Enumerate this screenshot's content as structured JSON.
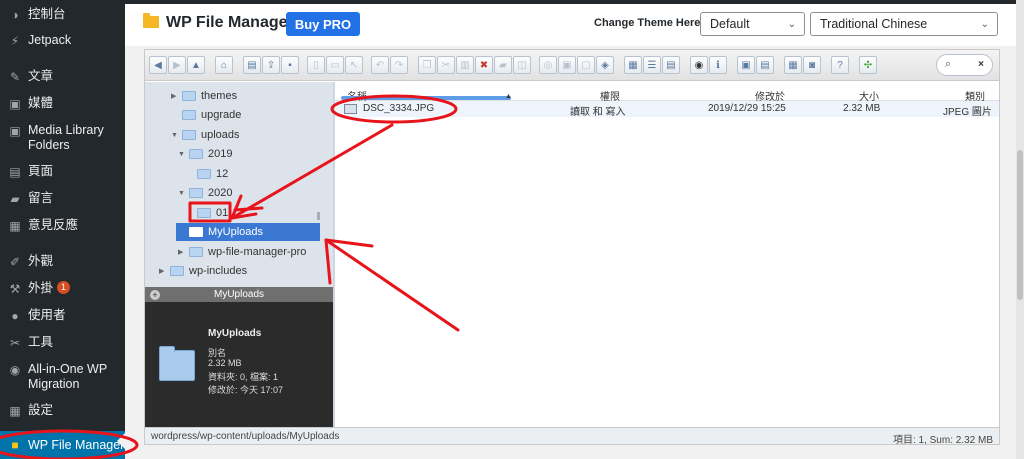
{
  "sidebar": {
    "items": [
      {
        "label": "控制台",
        "icon": "dashboard-icon"
      },
      {
        "label": "Jetpack",
        "icon": "jetpack-icon"
      },
      {
        "label": "文章",
        "icon": "pin-icon"
      },
      {
        "label": "媒體",
        "icon": "media-icon"
      },
      {
        "label": "Media Library Folders",
        "icon": "media-folders-icon"
      },
      {
        "label": "頁面",
        "icon": "page-icon"
      },
      {
        "label": "留言",
        "icon": "comment-icon"
      },
      {
        "label": "意見反應",
        "icon": "feedback-icon"
      },
      {
        "label": "外觀",
        "icon": "brush-icon"
      },
      {
        "label": "外掛",
        "icon": "plugin-icon",
        "badge": "1"
      },
      {
        "label": "使用者",
        "icon": "user-icon"
      },
      {
        "label": "工具",
        "icon": "wrench-icon"
      },
      {
        "label": "All-in-One WP Migration",
        "icon": "migration-icon"
      },
      {
        "label": "設定",
        "icon": "settings-icon"
      },
      {
        "label": "WP File Manager",
        "icon": "folder-icon"
      }
    ]
  },
  "header": {
    "title": "WP File Manager",
    "buy_pro": "Buy PRO",
    "theme_label": "Change Theme Here:",
    "theme_value": "Default",
    "language_value": "Traditional Chinese"
  },
  "tree": [
    {
      "label": "themes"
    },
    {
      "label": "upgrade"
    },
    {
      "label": "uploads"
    },
    {
      "label": "2019"
    },
    {
      "label": "12"
    },
    {
      "label": "2020"
    },
    {
      "label": "01"
    },
    {
      "label": "MyUploads"
    },
    {
      "label": "wp-file-manager-pro"
    },
    {
      "label": "wp-includes"
    }
  ],
  "info": {
    "header": "MyUploads",
    "name": "MyUploads",
    "kind": "別名",
    "size": "2.32 MB",
    "counts": "資料夾: 0, 檔案: 1",
    "modified": "修改於: 今天 17:07"
  },
  "columns": {
    "name": "名稱",
    "perm": "權限",
    "modified": "修改於",
    "size": "大小",
    "kind": "類別"
  },
  "files": [
    {
      "name": "DSC_3334.JPG",
      "perm": "讀取 和 寫入",
      "modified": "2019/12/29 15:25",
      "size": "2.32 MB",
      "kind": "JPEG 圖片"
    }
  ],
  "status": {
    "path": "wordpress/wp-content/uploads/MyUploads",
    "stat": "項目: 1, Sum: 2.32 MB"
  },
  "colors": {
    "admin_sidebar": "#23282d",
    "active_menu": "#0073aa",
    "buy_pro": "#2271e6",
    "selected_tree": "#3a78d4",
    "annotation": "#e8141c"
  }
}
